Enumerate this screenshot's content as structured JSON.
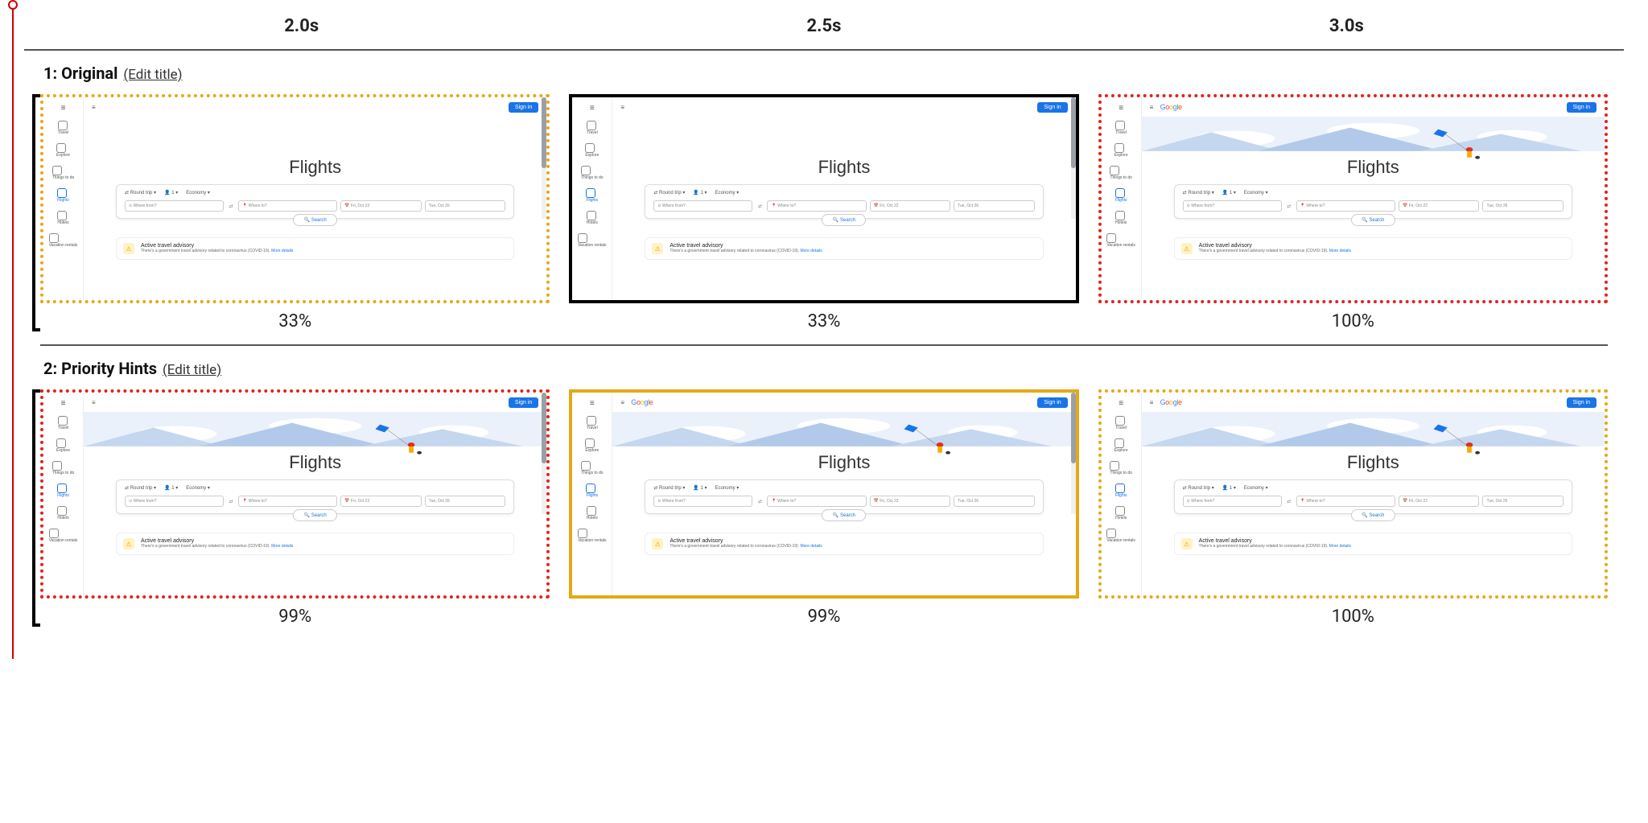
{
  "time_header": {
    "t1": "2.0s",
    "t2": "2.5s",
    "t3": "3.0s"
  },
  "rows": [
    {
      "prefix": "1: ",
      "title": "Original",
      "edit": "(Edit title)",
      "frames": [
        {
          "pct": "33%",
          "border": "border-dotted-amber",
          "bracket": true,
          "hero_image": false,
          "show_logo": false
        },
        {
          "pct": "33%",
          "border": "border-solid-black",
          "bracket": false,
          "hero_image": false,
          "show_logo": false
        },
        {
          "pct": "100%",
          "border": "border-dotted-red",
          "bracket": false,
          "hero_image": true,
          "show_logo": true
        }
      ]
    },
    {
      "prefix": "2: ",
      "title": "Priority Hints",
      "edit": "(Edit title)",
      "frames": [
        {
          "pct": "99%",
          "border": "border-dotted-red",
          "bracket": true,
          "hero_image": true,
          "show_logo": false
        },
        {
          "pct": "99%",
          "border": "border-solid-amber",
          "bracket": false,
          "hero_image": true,
          "show_logo": true
        },
        {
          "pct": "100%",
          "border": "border-dotted-amber",
          "bracket": false,
          "hero_image": true,
          "show_logo": true
        }
      ]
    }
  ],
  "mock": {
    "hero_title": "Flights",
    "signin": "Sign in",
    "logo": "Google",
    "sidebar": [
      "Travel",
      "Explore",
      "Things to do",
      "Flights",
      "Hotels",
      "Vacation rentals"
    ],
    "opts": {
      "trip": "Round trip",
      "pax": "1",
      "cls": "Economy"
    },
    "fields": {
      "from": "Where from?",
      "to": "Where to?",
      "dep": "Fri, Oct 22",
      "ret": "Tue, Oct 26"
    },
    "search_btn": "Search",
    "advisory": {
      "title": "Active travel advisory",
      "sub": "There's a government travel advisory related to coronavirus (COVID-19). ",
      "link": "More details"
    }
  }
}
